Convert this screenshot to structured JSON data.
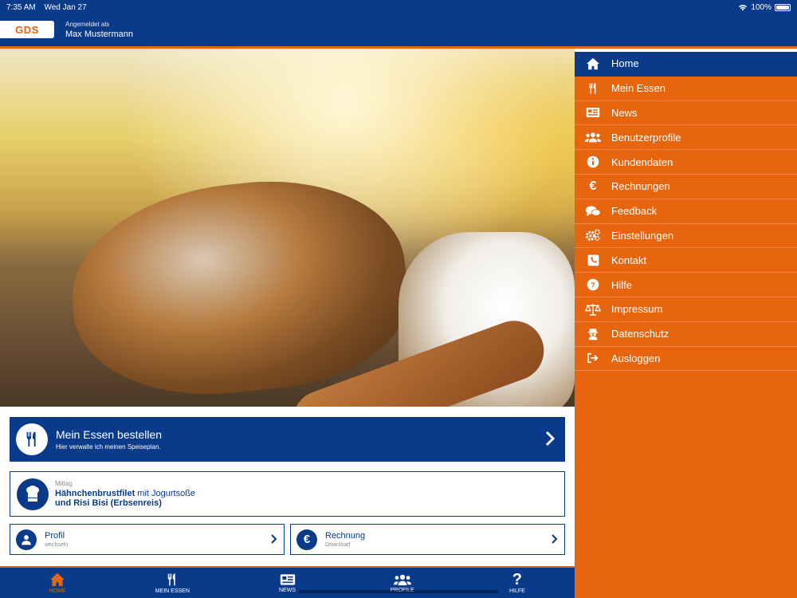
{
  "status": {
    "time": "7:35 AM",
    "date": "Wed Jan 27",
    "battery": "100%"
  },
  "header": {
    "logo": "GDS",
    "logged_label": "Angemeldet als",
    "user_name": "Max Mustermann"
  },
  "order_card": {
    "title": "Mein Essen bestellen",
    "subtitle": "Hier verwalte ich meinen Speiseplan.",
    "icon": "cutlery-icon"
  },
  "meal_card": {
    "label": "Mittag",
    "dish_bold": "Hähnchenbrustfilet",
    "dish_rest": " mit Jogurtsoße",
    "dish_line2": "und Risi Bisi (Erbsenreis)",
    "icon": "chef-hat-icon"
  },
  "profile_card": {
    "title": "Profil",
    "subtitle": "wechseln",
    "icon": "user-icon"
  },
  "invoice_card": {
    "title": "Rechnung",
    "subtitle": "Download",
    "icon": "euro-icon"
  },
  "tabs": [
    {
      "label": "HOME",
      "icon": "home-icon",
      "active": true
    },
    {
      "label": "MEIN ESSEN",
      "icon": "cutlery-icon"
    },
    {
      "label": "NEWS",
      "icon": "news-icon"
    },
    {
      "label": "PROFILE",
      "icon": "users-icon"
    },
    {
      "label": "HILFE",
      "icon": "question-icon"
    }
  ],
  "menu": [
    {
      "label": "Home",
      "icon": "home-icon",
      "active": true
    },
    {
      "label": "Mein Essen",
      "icon": "cutlery-icon"
    },
    {
      "label": "News",
      "icon": "news-icon"
    },
    {
      "label": "Benutzerprofile",
      "icon": "users-icon"
    },
    {
      "label": "Kundendaten",
      "icon": "info-icon"
    },
    {
      "label": "Rechnungen",
      "icon": "euro-icon"
    },
    {
      "label": "Feedback",
      "icon": "comments-icon"
    },
    {
      "label": "Einstellungen",
      "icon": "gears-icon"
    },
    {
      "label": "Kontakt",
      "icon": "phone-icon"
    },
    {
      "label": "Hilfe",
      "icon": "question-icon"
    },
    {
      "label": "Impressum",
      "icon": "balance-icon"
    },
    {
      "label": "Datenschutz",
      "icon": "privacy-icon"
    },
    {
      "label": "Ausloggen",
      "icon": "logout-icon"
    }
  ],
  "colors": {
    "brand_blue": "#0a3a8a",
    "brand_orange": "#e8650f"
  }
}
